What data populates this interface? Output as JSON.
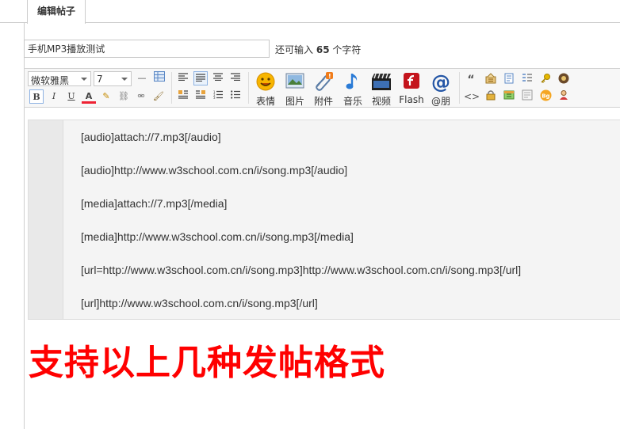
{
  "tab": {
    "label": "编辑帖子"
  },
  "subject": {
    "value": "手机MP3播放测试"
  },
  "remain": {
    "prefix": "还可输入",
    "count": "65",
    "suffix": "个字符"
  },
  "toolbar": {
    "font_family": "微软雅黑",
    "font_size": "7",
    "buttons": {
      "bold": "B",
      "italic": "I",
      "underline": "U",
      "color": "A",
      "hr": "—"
    },
    "big_buttons": [
      {
        "label": "表情",
        "icon": "smiley-icon"
      },
      {
        "label": "图片",
        "icon": "image-icon"
      },
      {
        "label": "附件",
        "icon": "paperclip-icon"
      },
      {
        "label": "音乐",
        "icon": "music-note-icon"
      },
      {
        "label": "视频",
        "icon": "video-icon"
      },
      {
        "label": "Flash",
        "icon": "flash-icon"
      },
      {
        "label": "@朋",
        "icon": "at-icon"
      }
    ],
    "quote": "“",
    "code": "<>"
  },
  "editor": {
    "lines": [
      "[audio]attach://7.mp3[/audio]",
      "[audio]http://www.w3school.com.cn/i/song.mp3[/audio]",
      "[media]attach://7.mp3[/media]",
      "[media]http://www.w3school.com.cn/i/song.mp3[/media]",
      "[url=http://www.w3school.com.cn/i/song.mp3]http://www.w3school.com.cn/i/song.mp3[/url]",
      "[url]http://www.w3school.com.cn/i/song.mp3[/url]"
    ]
  },
  "headline": "支持以上几种发帖格式"
}
